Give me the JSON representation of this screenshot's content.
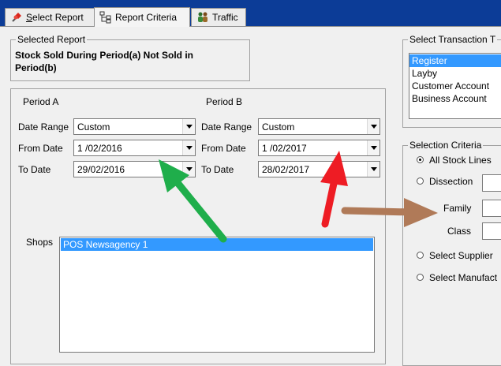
{
  "tabs": [
    {
      "label": "Select Report",
      "accel": "S",
      "rest": "elect Report"
    },
    {
      "label": "Report Criteria",
      "accel": "",
      "rest": "Report Criteria"
    },
    {
      "label": "Traffic",
      "accel": "",
      "rest": "Traffic"
    }
  ],
  "selected_report": {
    "legend": "Selected Report",
    "title": "Stock Sold During Period(a) Not Sold in Period(b)"
  },
  "period_a": {
    "header": "Period A",
    "date_range_label": "Date Range",
    "date_range_value": "Custom",
    "from_label": "From Date",
    "from_value": "1 /02/2016",
    "to_label": "To Date",
    "to_value": "29/02/2016"
  },
  "period_b": {
    "header": "Period B",
    "date_range_label": "Date Range",
    "date_range_value": "Custom",
    "from_label": "From Date",
    "from_value": "1 /02/2017",
    "to_label": "To Date",
    "to_value": "28/02/2017"
  },
  "shops": {
    "label": "Shops",
    "items": [
      "POS Newsagency 1"
    ]
  },
  "transaction_types": {
    "legend": "Select Transaction T",
    "items": [
      "Register",
      "Layby",
      "Customer Account",
      "Business Account"
    ]
  },
  "selection_criteria": {
    "legend": "Selection Criteria",
    "all_stock": "All Stock Lines",
    "dissection": "Dissection",
    "family": "Family",
    "class": "Class",
    "select_supplier": "Select Supplier",
    "select_manufacturer": "Select Manufact"
  },
  "colors": {
    "title_bar": "#0c3c97",
    "selection": "#3399ff",
    "arrow_green": "#1fae4b",
    "arrow_red": "#ee1c24",
    "arrow_brown": "#b07a58"
  }
}
